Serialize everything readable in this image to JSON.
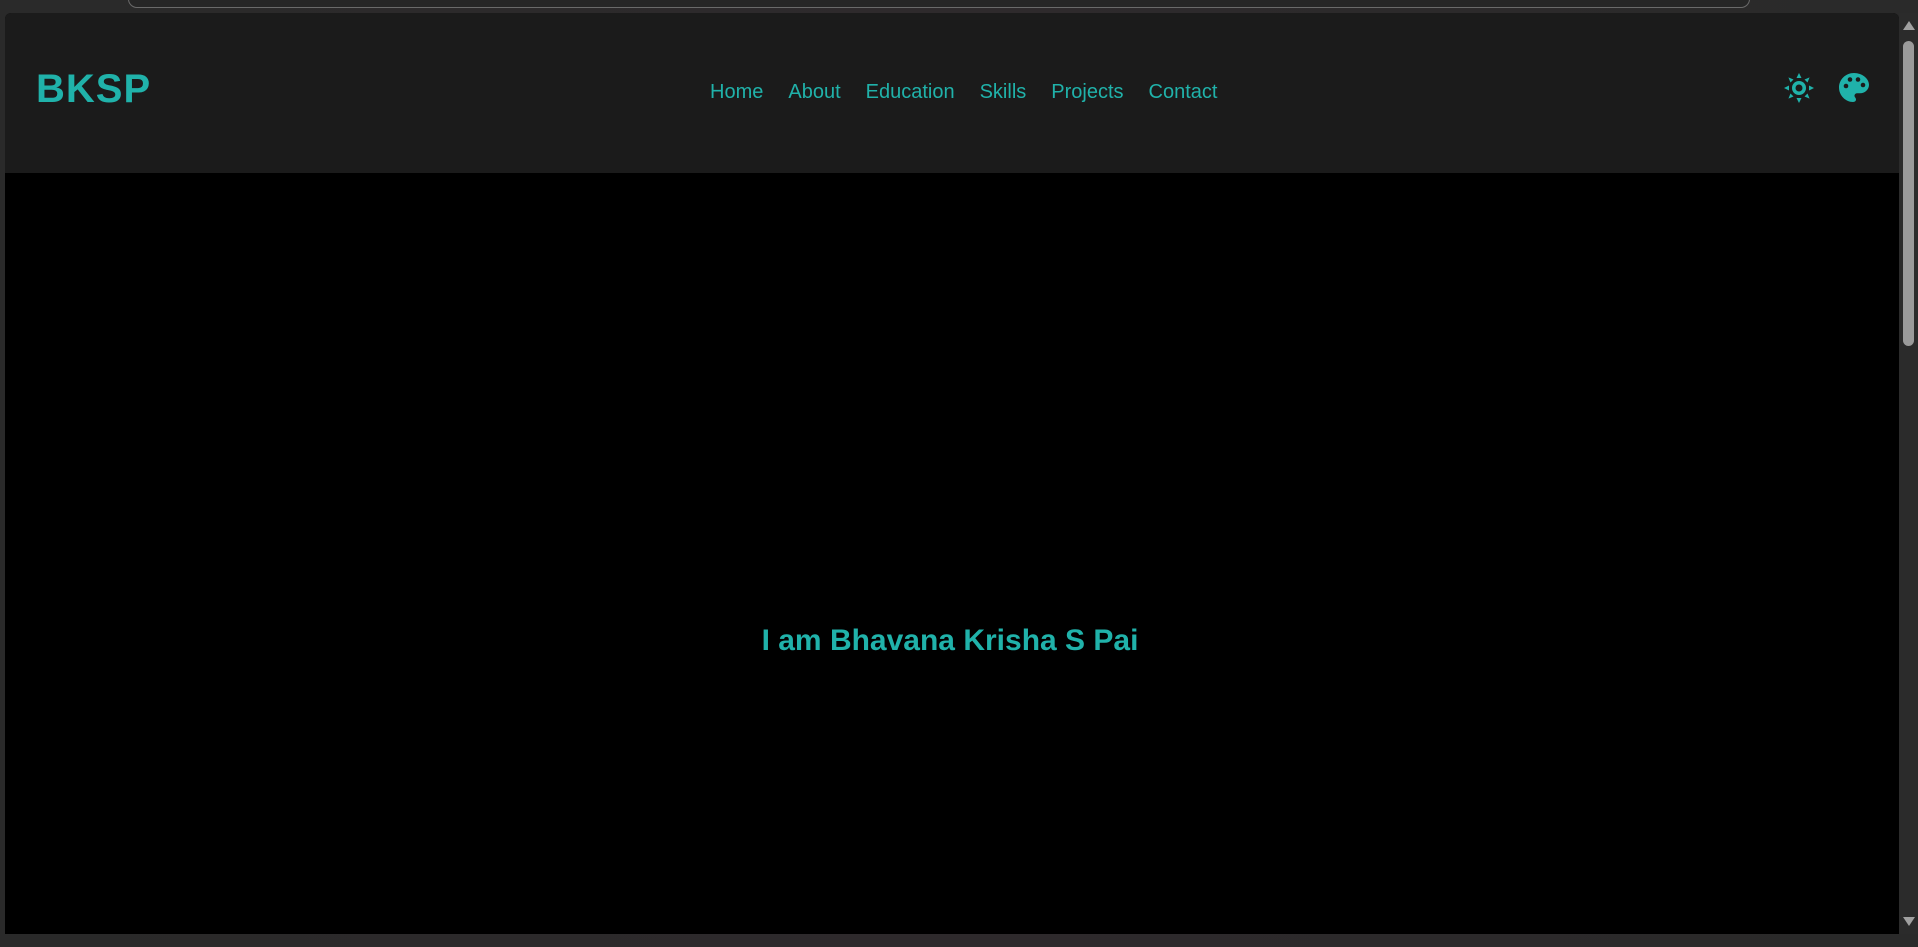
{
  "header": {
    "logo": "BKSP",
    "nav": [
      {
        "label": "Home"
      },
      {
        "label": "About"
      },
      {
        "label": "Education"
      },
      {
        "label": "Skills"
      },
      {
        "label": "Projects"
      },
      {
        "label": "Contact"
      }
    ],
    "icons": [
      "sun-icon",
      "palette-icon"
    ]
  },
  "hero": {
    "title": "I am Bhavana Krisha S Pai"
  },
  "colors": {
    "accent": "#20b2aa",
    "navbar_bg": "#1b1b1b",
    "page_bg": "#000000"
  }
}
